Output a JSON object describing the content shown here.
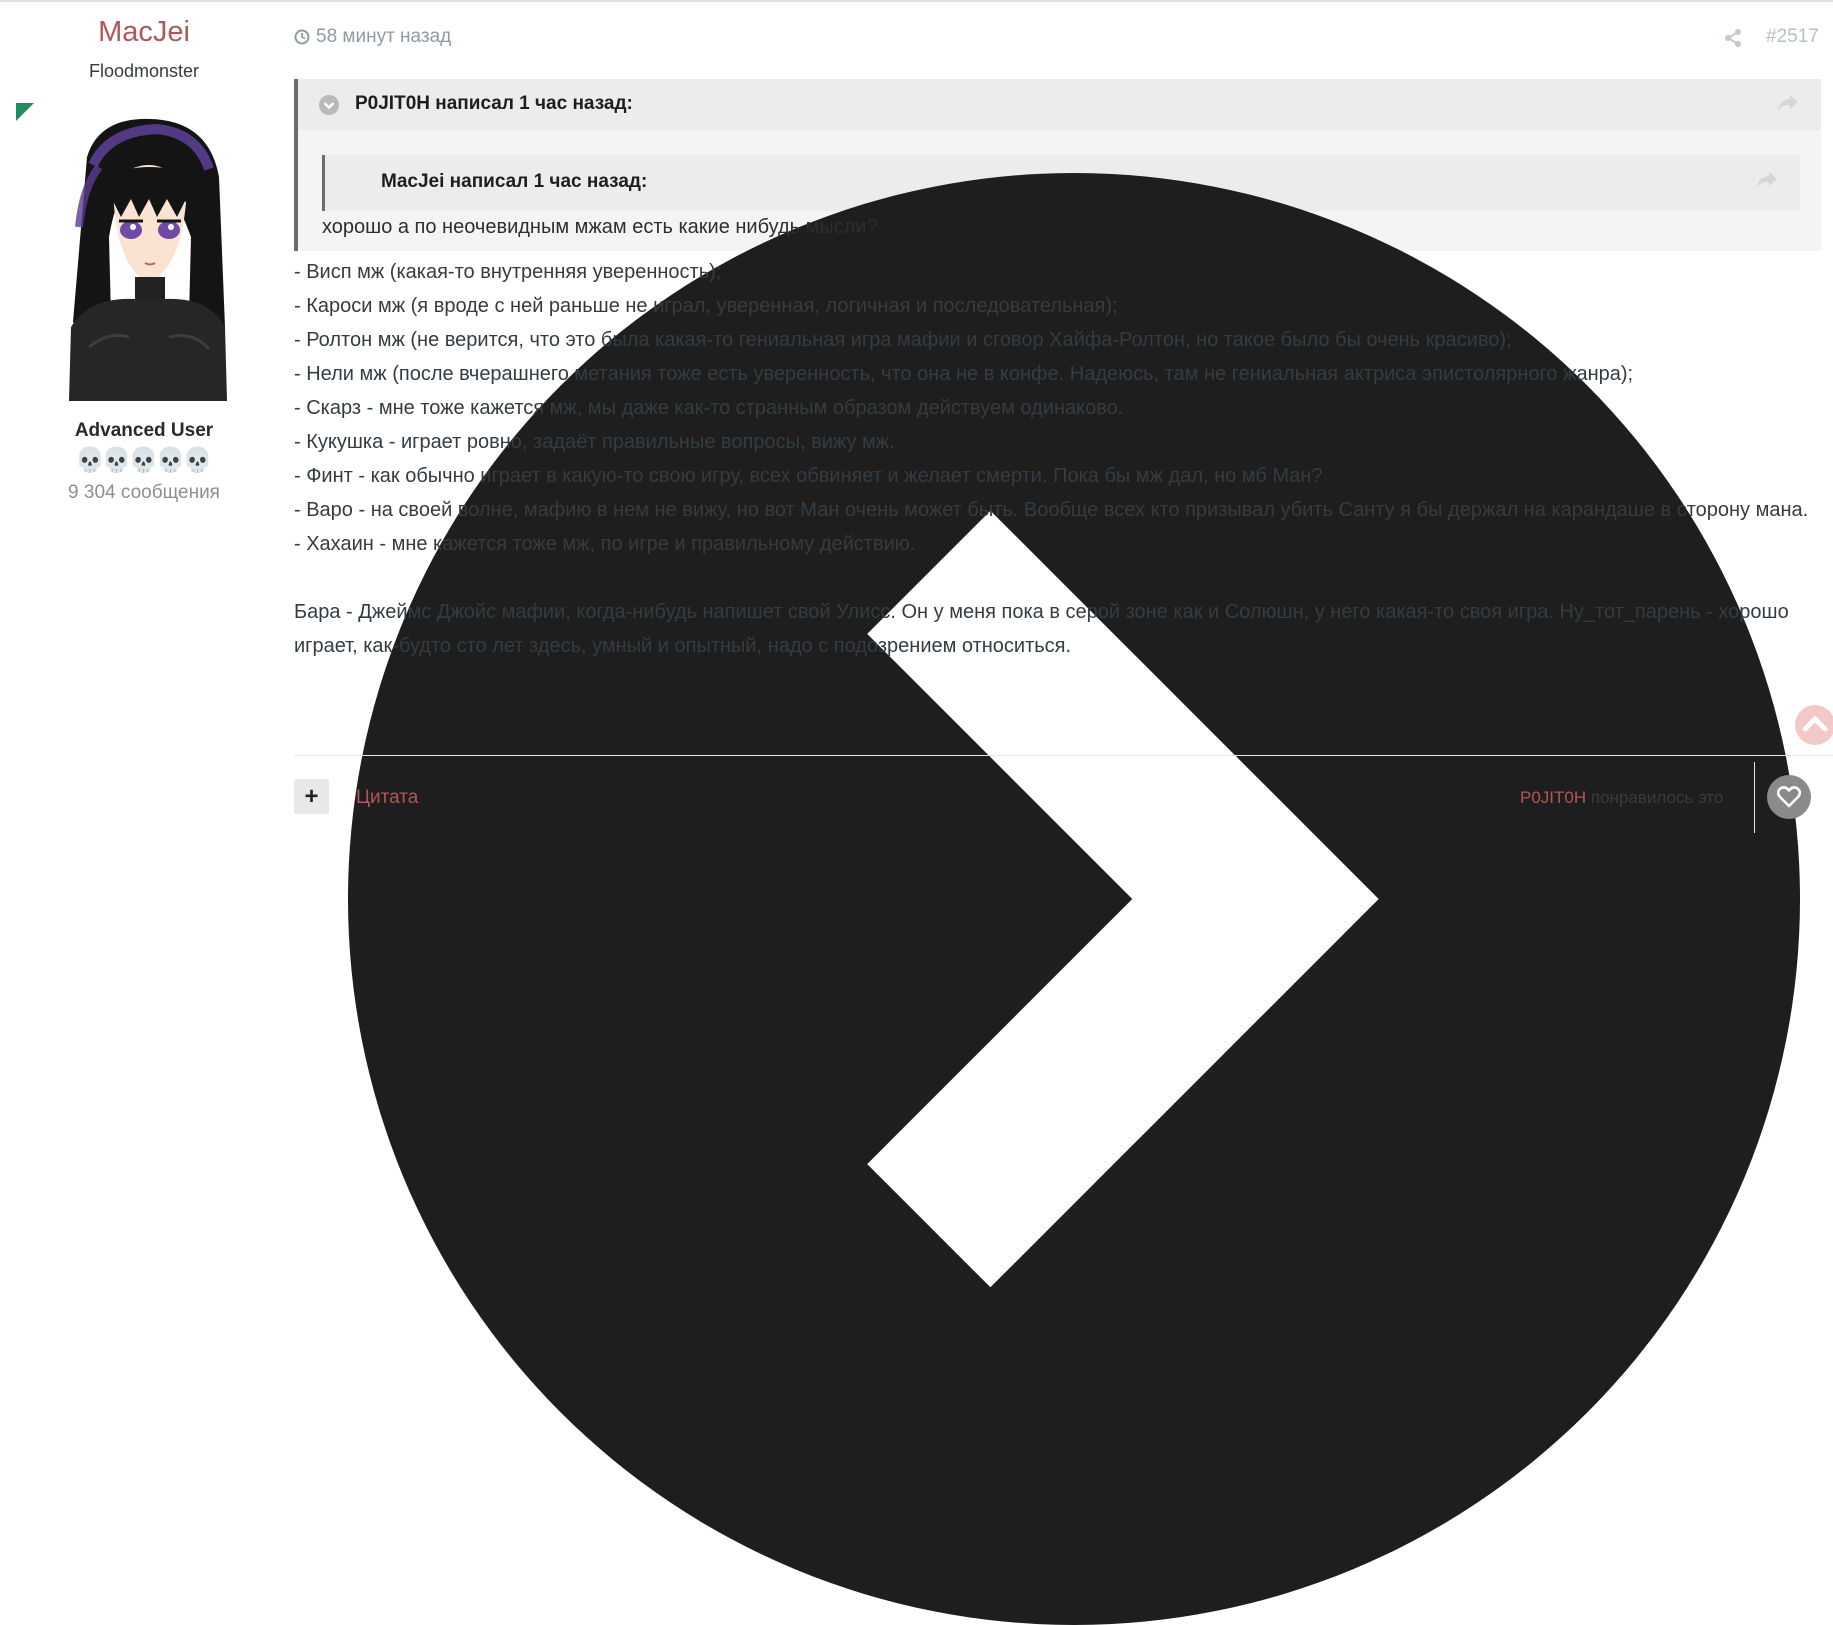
{
  "author": {
    "name": "MacJei",
    "group": "Floodmonster",
    "rank": "Advanced User",
    "post_count": "9 304 сообщения",
    "rank_pips": "💀💀💀💀💀"
  },
  "post": {
    "time": "58 минут назад",
    "number": "#2517"
  },
  "quote_outer": {
    "title": "P0JIT0H написал 1 час назад:",
    "text": "хорошо а по неочевидным мжам есть какие нибудь мысли?"
  },
  "quote_inner": {
    "title": "MacJei написал 1 час назад:"
  },
  "body": {
    "lines": [
      "- Висп мж (какая-то внутренняя уверенность);",
      "- Кароси мж (я вроде с ней раньше не играл, уверенная, логичная и последовательная);",
      "- Ролтон мж (не верится, что это была какая-то гениальная игра мафии и сговор Хайфа-Ролтон, но такое было бы очень красиво);",
      "- Нели мж (после вчерашнего метания тоже есть уверенность, что она не в конфе. Надеюсь, там не гениальная актриса эпистолярного жанра);",
      "- Скарз - мне тоже кажется мж, мы даже как-то странным образом действуем одинаково.",
      "- Кукушка - играет ровно, задаёт правильные вопросы, вижу мж.",
      "- Финт - как обычно играет в какую-то свою игру, всех обвиняет и желает смерти. Пока бы мж дал, но мб Ман?",
      "- Варо - на своей волне, мафию в нем не вижу, но вот Ман очень может быть. Вообще всех кто призывал убить Санту я бы держал на карандаше в сторону мана.",
      "- Хахаин - мне кажется тоже мж, по игре и правильному действию."
    ],
    "closing": "Бара - Джеймс Джойс мафии, когда-нибудь напишет свой Улисс. Он у меня пока в серой зоне как и Солюшн, у него какая-то своя игра. Ну_тот_парень - хорошо играет, как-будто сто лет здесь, умный и опытный, надо с подозрением относиться."
  },
  "footer": {
    "multiquote_label": "+",
    "quote_label": "Цитата",
    "liker": "P0JIT0H",
    "liked_text": " понравилось это"
  },
  "colors": {
    "accent": "#b1565a",
    "online": "#1f8f5f",
    "muted": "#8e9ba3"
  }
}
